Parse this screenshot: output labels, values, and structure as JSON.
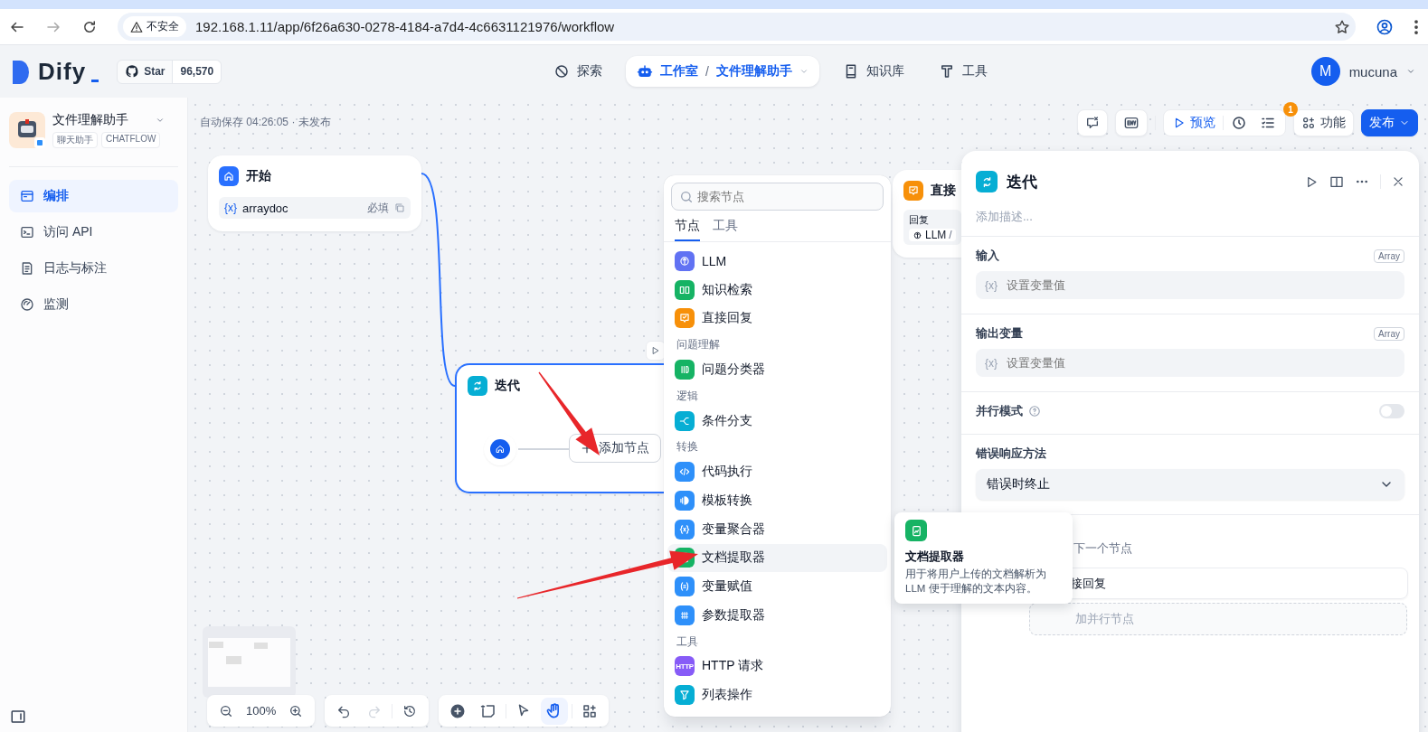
{
  "browser": {
    "security": "不安全",
    "url": "192.168.1.11/app/6f26a630-0278-4184-a7d4-4c6631121976/workflow"
  },
  "header": {
    "logo": "Dify",
    "star_label": "Star",
    "star_count": "96,570",
    "nav": [
      {
        "label": "探索",
        "selected": false
      },
      {
        "label": "工作室",
        "selected": true,
        "separator": "/",
        "app": "文件理解助手"
      },
      {
        "label": "知识库",
        "selected": false
      },
      {
        "label": "工具",
        "selected": false
      }
    ],
    "user": {
      "initial": "M",
      "name": "mucuna"
    }
  },
  "app": {
    "name": "文件理解助手",
    "tags": [
      "聊天助手",
      "CHATFLOW"
    ]
  },
  "sidebar": {
    "items": [
      {
        "label": "编排",
        "selected": true
      },
      {
        "label": "访问 API",
        "selected": false
      },
      {
        "label": "日志与标注",
        "selected": false
      },
      {
        "label": "监测",
        "selected": false
      }
    ]
  },
  "canvas": {
    "autosave": "自动保存 04:26:05 · 未发布",
    "toolbar": {
      "preview": "预览",
      "checklist_badge": "1",
      "features": "功能",
      "publish": "发布"
    },
    "start_node": {
      "title": "开始",
      "variables": [
        {
          "prefix": "{x}",
          "name": "arraydoc",
          "required": "必填"
        }
      ]
    },
    "iteration_node": {
      "title": "迭代",
      "add_label": "添加节点"
    },
    "answer_node": {
      "title": "直接",
      "label": "回复",
      "source": "LLM",
      "separator": "/"
    },
    "zoom": "100%",
    "tools": [
      {
        "kind": "add",
        "selected": false
      },
      {
        "kind": "note",
        "selected": false
      },
      {
        "kind": "pointer",
        "selected": false
      },
      {
        "kind": "hand",
        "selected": true
      },
      {
        "kind": "layout",
        "selected": false
      }
    ]
  },
  "node_menu": {
    "search": {
      "placeholder": "搜索节点"
    },
    "tabs": [
      {
        "label": "节点",
        "selected": true
      },
      {
        "label": "工具",
        "selected": false
      }
    ],
    "entries": [
      {
        "kind": "node",
        "label": "LLM",
        "color": "#6172f3",
        "selected": false
      },
      {
        "kind": "node",
        "label": "知识检索",
        "color": "#16b364",
        "selected": false
      },
      {
        "kind": "node",
        "label": "直接回复",
        "color": "#f79009",
        "selected": false
      },
      {
        "kind": "group",
        "label": "问题理解"
      },
      {
        "kind": "node",
        "label": "问题分类器",
        "color": "#16b364",
        "selected": false
      },
      {
        "kind": "group",
        "label": "逻辑"
      },
      {
        "kind": "node",
        "label": "条件分支",
        "color": "#06aed4",
        "selected": false
      },
      {
        "kind": "group",
        "label": "转换"
      },
      {
        "kind": "node",
        "label": "代码执行",
        "color": "#2e90fa",
        "selected": false
      },
      {
        "kind": "node",
        "label": "模板转换",
        "color": "#2e90fa",
        "selected": false
      },
      {
        "kind": "node",
        "label": "变量聚合器",
        "color": "#2e90fa",
        "selected": false
      },
      {
        "kind": "node",
        "label": "文档提取器",
        "color": "#16b364",
        "selected": true
      },
      {
        "kind": "node",
        "label": "变量赋值",
        "color": "#2e90fa",
        "selected": false
      },
      {
        "kind": "node",
        "label": "参数提取器",
        "color": "#2e90fa",
        "selected": false
      },
      {
        "kind": "group",
        "label": "工具"
      },
      {
        "kind": "node",
        "label": "HTTP 请求",
        "icon_text": "HTTP",
        "color": "#875bf7",
        "selected": false
      },
      {
        "kind": "node",
        "label": "列表操作",
        "color": "#06aed4",
        "selected": false
      }
    ]
  },
  "tooltip": {
    "title": "文档提取器",
    "description": "用于将用户上传的文档解析为 LLM 便于理解的文本内容。",
    "color": "#16b364"
  },
  "panel": {
    "title": "迭代",
    "description_placeholder": "添加描述...",
    "input": {
      "label": "输入",
      "type": "Array",
      "prefix": "{x}",
      "placeholder": "设置变量值"
    },
    "output": {
      "label": "输出变量",
      "type": "Array",
      "prefix": "{x}",
      "placeholder": "设置变量值"
    },
    "parallel": {
      "label": "并行模式",
      "on": false
    },
    "error": {
      "label": "错误响应方法",
      "value": "错误时终止"
    },
    "next": {
      "hint": "下一个节点",
      "node": "接回复",
      "add": "加并行节点"
    }
  }
}
